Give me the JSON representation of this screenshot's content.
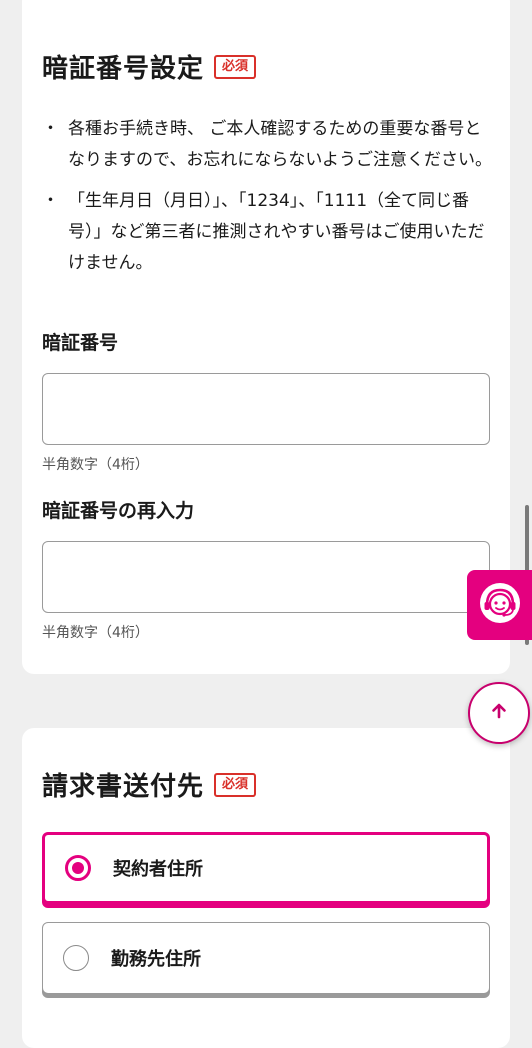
{
  "pin_section": {
    "title": "暗証番号設定",
    "required_badge": "必須",
    "notes": [
      "各種お手続き時、 ご本人確認するための重要な番号となりますので、お忘れにならないようご注意ください。",
      "「生年月日（月日）」、「1234」、「1111（全て同じ番号）」など第三者に推測されやすい番号はご使用いただけません。"
    ],
    "pin_field": {
      "label": "暗証番号",
      "value": "",
      "hint": "半角数字（4桁）"
    },
    "pin_confirm_field": {
      "label": "暗証番号の再入力",
      "value": "",
      "hint": "半角数字（4桁）"
    }
  },
  "billing_section": {
    "title": "請求書送付先",
    "required_badge": "必須",
    "options": [
      {
        "label": "契約者住所",
        "selected": true
      },
      {
        "label": "勤務先住所",
        "selected": false
      }
    ]
  },
  "colors": {
    "accent": "#e4007f",
    "required": "#d9302a",
    "card_bg": "#ffffff",
    "page_bg": "#efefef"
  },
  "icons": {
    "support": "headset-support-icon",
    "scroll_top": "arrow-up-icon"
  }
}
